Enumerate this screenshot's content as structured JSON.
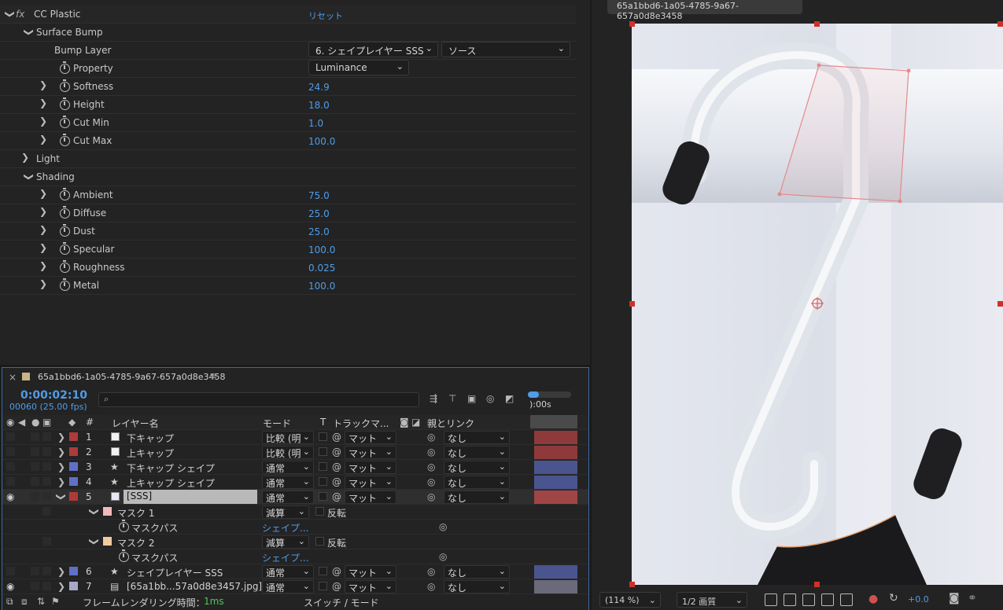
{
  "effects": {
    "effect_name": "CC Plastic",
    "fx_label": "fx",
    "reset_label": "リセット",
    "surface_bump": "Surface Bump",
    "bump_layer_label": "Bump Layer",
    "bump_layer_value": "6. シェイプレイヤー SSS",
    "bump_source_value": "ソース",
    "property_label": "Property",
    "property_value": "Luminance",
    "softness_label": "Softness",
    "softness_value": "24.9",
    "height_label": "Height",
    "height_value": "18.0",
    "cutmin_label": "Cut Min",
    "cutmin_value": "1.0",
    "cutmax_label": "Cut Max",
    "cutmax_value": "100.0",
    "light_label": "Light",
    "shading_label": "Shading",
    "ambient_label": "Ambient",
    "ambient_value": "75.0",
    "diffuse_label": "Diffuse",
    "diffuse_value": "25.0",
    "dust_label": "Dust",
    "dust_value": "25.0",
    "specular_label": "Specular",
    "specular_value": "100.0",
    "roughness_label": "Roughness",
    "roughness_value": "0.025",
    "metal_label": "Metal",
    "metal_value": "100.0"
  },
  "viewer": {
    "comp_tab": "65a1bbd6-1a05-4785-9a67-657a0d8e3458",
    "zoom": "(114 %)",
    "quality": "1/2 画質",
    "exposure": "+0.0"
  },
  "timeline": {
    "comp_name": "65a1bbd6-1a05-4785-9a67-657a0d8e3458",
    "timecode": "0:00:02:10",
    "frames": "00060 (25.00 fps)",
    "search_placeholder": "",
    "ruler_label": "):00s",
    "col_hash": "#",
    "col_layer_name": "レイヤー名",
    "col_mode": "モード",
    "col_t": "T",
    "col_track_matte": "トラックマ...",
    "col_parent": "親とリンク",
    "footer_render_label": "フレームレンダリング時間：",
    "footer_render_value": "1ms",
    "footer_switch": "スイッチ / モード",
    "layers": [
      {
        "num": "1",
        "name": "下キャップ",
        "mode": "比較 (明",
        "matte": "マット",
        "parent": "なし",
        "color": "#b03a3a",
        "bar": "#8f3a3a"
      },
      {
        "num": "2",
        "name": "上キャップ",
        "mode": "比較 (明",
        "matte": "マット",
        "parent": "なし",
        "color": "#b03a3a",
        "bar": "#8f3a3a"
      },
      {
        "num": "3",
        "name": "下キャップ シェイプ",
        "mode": "通常",
        "matte": "マット",
        "parent": "なし",
        "color": "#6070c8",
        "bar": "#4a5590"
      },
      {
        "num": "4",
        "name": "上キャップ シェイプ",
        "mode": "通常",
        "matte": "マット",
        "parent": "なし",
        "color": "#6070c8",
        "bar": "#4a5590"
      },
      {
        "num": "5",
        "name": "[SSS]",
        "mode": "通常",
        "matte": "マット",
        "parent": "なし",
        "color": "#b03a3a",
        "bar": "#a04545"
      },
      {
        "num": "6",
        "name": "シェイプレイヤー SSS",
        "mode": "通常",
        "matte": "マット",
        "parent": "なし",
        "color": "#6070c8",
        "bar": "#4a5590"
      },
      {
        "num": "7",
        "name": "[65a1bb...57a0d8e3457.jpg]",
        "mode": "通常",
        "matte": "マット",
        "parent": "なし",
        "color": "#a8a8c8",
        "bar": "#6a6a7a"
      }
    ],
    "mask1": "マスク 1",
    "mask2": "マスク 2",
    "mask_mode": "減算",
    "invert": "反転",
    "mask_path": "マスクパス",
    "shape_link": "シェイプ..."
  }
}
